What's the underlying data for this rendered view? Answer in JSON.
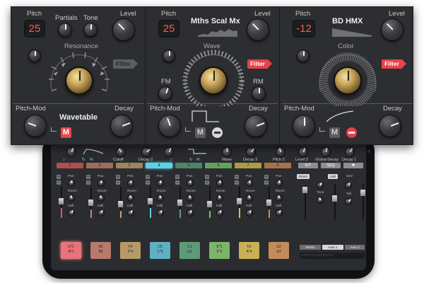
{
  "modules": [
    {
      "name": "module-wavetable",
      "pitch_label": "Pitch",
      "pitch_value": "25",
      "partials_label": "Partials",
      "tone_label": "Tone",
      "level_label": "Level",
      "section_label": "Resonance",
      "filter_label": "Filter",
      "filter_active": false,
      "pitch_mod_label": "Pitch-Mod",
      "engine_title": "Wavetable",
      "decay_label": "Decay",
      "mod_icon": "M"
    },
    {
      "name": "module-maths-scale",
      "pitch_label": "Pitch",
      "pitch_value": "25",
      "engine_title": "Mths Scal Mx",
      "level_label": "Level",
      "section_label": "Wave",
      "filter_label": "Filter",
      "filter_active": true,
      "fm_label": "FM",
      "rm_label": "RM",
      "pitch_mod_label": "Pitch-Mod",
      "decay_label": "Decay",
      "mod_icon": "M"
    },
    {
      "name": "module-bd-hmx",
      "pitch_label": "Pitch",
      "pitch_value": "-12",
      "engine_title": "BD HMX",
      "level_label": "Level",
      "section_label": "Color",
      "filter_label": "Filter",
      "filter_active": true,
      "pitch_mod_label": "Pitch-Mod",
      "decay_label": "Decay",
      "mod_icon": "M"
    }
  ],
  "tablet": {
    "knob_labels": [
      "Cutoff",
      "Decay 2",
      "Wave",
      "Decay 3",
      "Pitch 2",
      "Level 3",
      "Global Decay",
      "Decay 1"
    ],
    "tabs": [
      {
        "label": "1",
        "color": "#e05a5a"
      },
      {
        "label": "2",
        "color": "#c9806e"
      },
      {
        "label": "3",
        "color": "#c7a070"
      },
      {
        "label": "4",
        "color": "#5fd0e6"
      },
      {
        "label": "5",
        "color": "#5aa37d"
      },
      {
        "label": "6",
        "color": "#79c96a"
      },
      {
        "label": "7",
        "color": "#d9c24e"
      },
      {
        "label": "8",
        "color": "#d28a4e"
      }
    ],
    "kit_label": "KIT",
    "seq_label": "SEQ",
    "strip_labels": {
      "pan": "Pan",
      "room": "Room",
      "hall": "Hall"
    },
    "right_labels": {
      "room": "Room",
      "hall": "Hall",
      "size": "Size",
      "tone": "Tone",
      "tail": "Tail"
    },
    "pads": [
      {
        "top": "G*1",
        "bottom": "A*1",
        "color": "#e8737b"
      },
      {
        "top": "A0",
        "bottom": "B0",
        "color": "#b77a6c"
      },
      {
        "top": "F4",
        "bottom": "F*4",
        "color": "#b79967"
      },
      {
        "top": "C5",
        "bottom": "C*5",
        "color": "#5fb0c3"
      },
      {
        "top": "C1",
        "bottom": "G1",
        "color": "#5f9a78"
      },
      {
        "top": "E*1",
        "bottom": "F*2",
        "color": "#7cb56a"
      },
      {
        "top": "F3",
        "bottom": "A*4",
        "color": "#c8b153"
      },
      {
        "top": "G2",
        "bottom": "E3",
        "color": "#c38b5a"
      }
    ],
    "bottom_buttons": [
      "Remix",
      "Auto 1",
      "Auto 2"
    ]
  }
}
